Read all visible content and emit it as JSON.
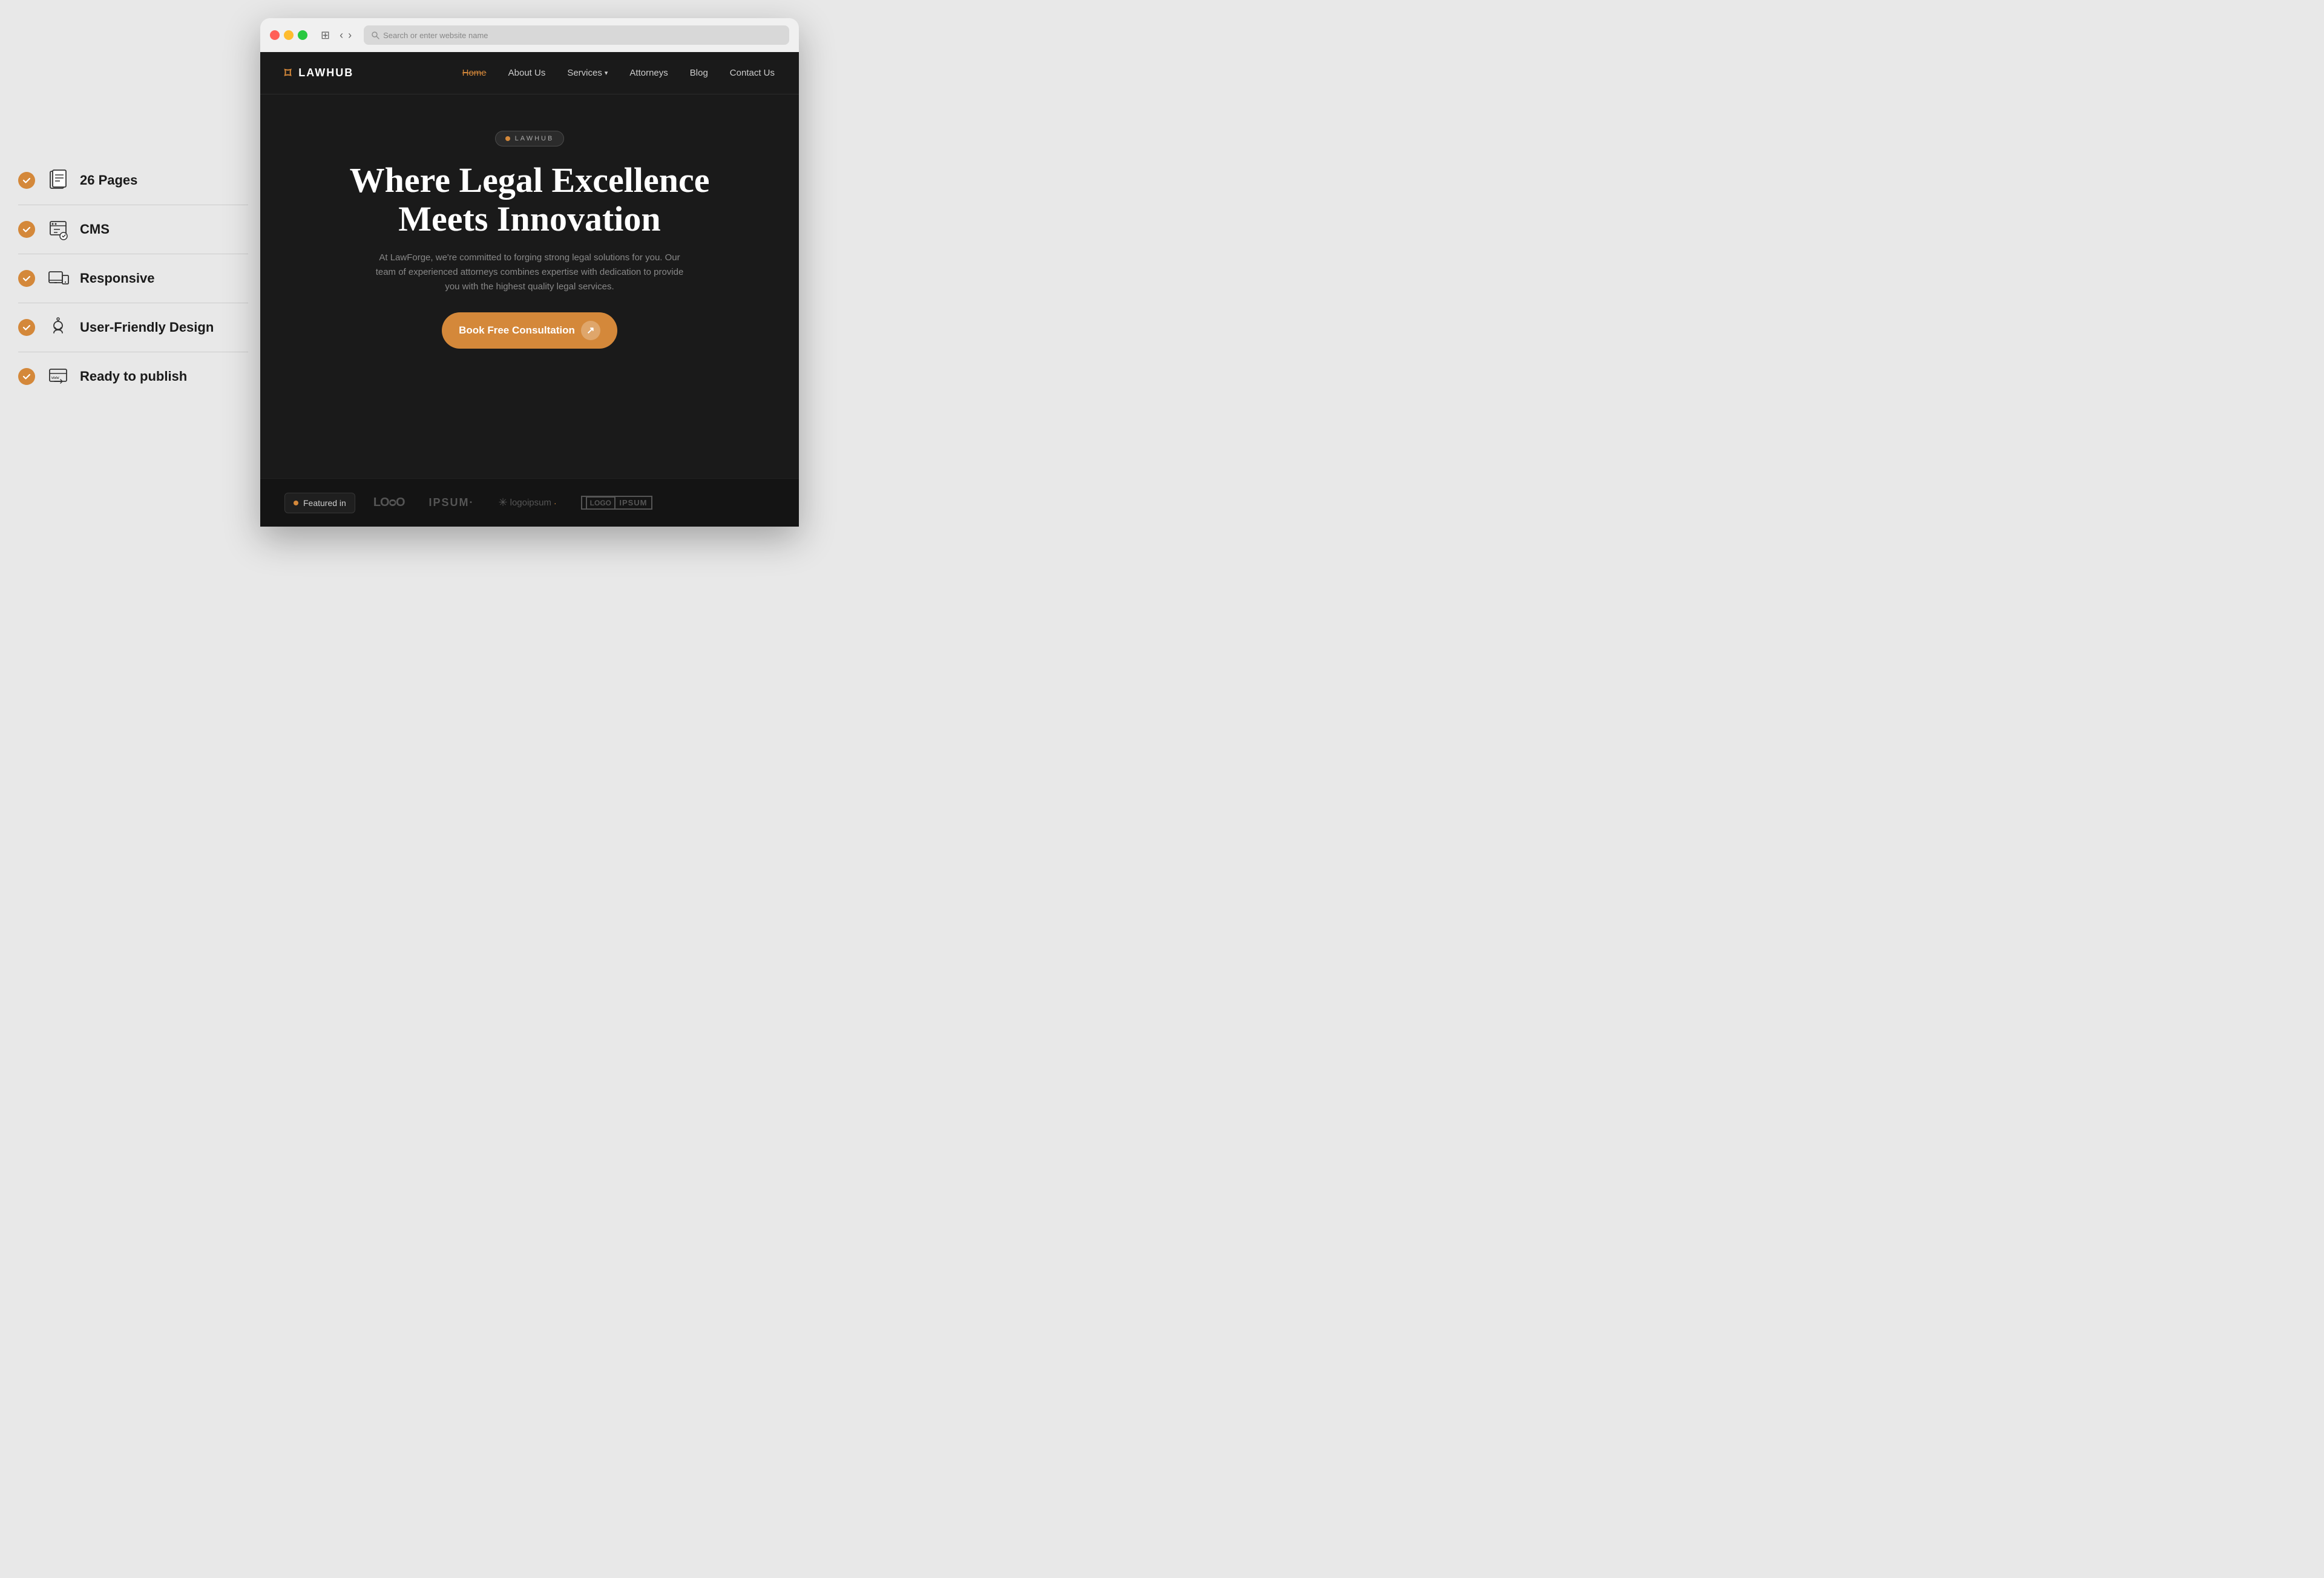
{
  "browser": {
    "url_placeholder": "Search or enter website name"
  },
  "sidebar": {
    "features": [
      {
        "id": "pages",
        "label": "26 Pages",
        "icon": "pages-icon"
      },
      {
        "id": "cms",
        "label": "CMS",
        "icon": "cms-icon"
      },
      {
        "id": "responsive",
        "label": "Responsive",
        "icon": "responsive-icon"
      },
      {
        "id": "user-friendly",
        "label": "User-Friendly Design",
        "icon": "user-friendly-icon"
      },
      {
        "id": "publish",
        "label": "Ready to publish",
        "icon": "publish-icon"
      }
    ]
  },
  "website": {
    "logo": {
      "text": "LAWHUB"
    },
    "nav": {
      "home": "Home",
      "about": "About Us",
      "services": "Services",
      "attorneys": "Attorneys",
      "blog": "Blog",
      "contact": "Contact Us"
    },
    "hero": {
      "badge": "LAWHUB",
      "title_line1": "Where Legal Excellence",
      "title_line2": "Meets Innovation",
      "subtitle": "At LawForge, we're committed to forging strong legal solutions for you. Our team of experienced attorneys combines expertise with dedication to provide you with the highest quality legal services.",
      "cta": "Book Free Consultation"
    },
    "featured": {
      "label": "Featured in",
      "logos": [
        "LOQO",
        "IPSUM",
        "logoipsum",
        "LOGO IPSUM"
      ]
    }
  }
}
